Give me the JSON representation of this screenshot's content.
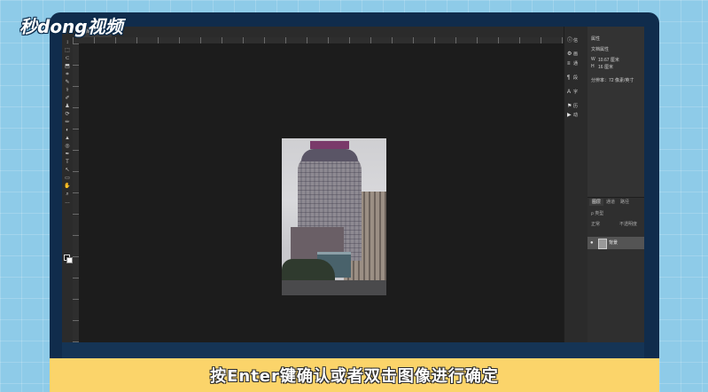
{
  "logo": {
    "text": "秒dong视频"
  },
  "document": {
    "tab_label": "文档名称 *",
    "tab_close": "×"
  },
  "tools": [
    "↕",
    "⬚",
    "⊂",
    "⬒",
    "⌗",
    "✎",
    "⚕",
    "✐",
    "♟",
    "⟳",
    "✏",
    "◐",
    "▲",
    "◎",
    "✒",
    "T",
    "↖",
    "▭",
    "✋",
    "⌕",
    "…"
  ],
  "mini_panel": [
    {
      "glyph": "ⓘ",
      "label": "信"
    },
    {
      "glyph": "⚙",
      "label": "画"
    },
    {
      "glyph": "≡",
      "label": "通"
    },
    {
      "glyph": "¶",
      "label": "段"
    },
    {
      "glyph": "A",
      "label": "字"
    },
    {
      "glyph": "⚑",
      "label": "历"
    },
    {
      "glyph": "▶",
      "label": "动"
    }
  ],
  "properties": {
    "title": "属性",
    "doc_label": "文档属性",
    "width_label": "W",
    "width_value": "10.67 厘米",
    "height_label": "H",
    "height_value": "16 厘米",
    "resolution": "分辨率：72 像素/英寸"
  },
  "layers": {
    "tabs": [
      "图层",
      "通道",
      "路径"
    ],
    "filter_placeholder": "ρ 类型",
    "blend_mode": "正常",
    "opacity_label": "不透明度",
    "items": [
      {
        "name": "背景"
      }
    ]
  },
  "subtitle": "按Enter键确认或者双击图像进行确定"
}
